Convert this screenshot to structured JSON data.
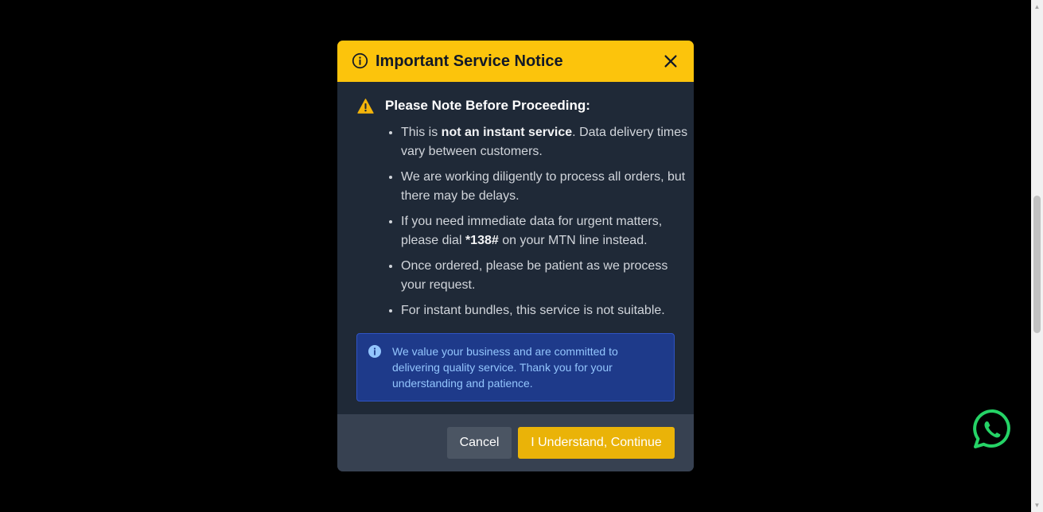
{
  "modal": {
    "title": "Important Service Notice",
    "note_heading": "Please Note Before Proceeding:",
    "items": [
      {
        "pre": "This is ",
        "bold": "not an instant service",
        "post": ". Data delivery times vary between customers."
      },
      {
        "pre": "We are working diligently to process all orders, but there may be delays.",
        "bold": "",
        "post": ""
      },
      {
        "pre": "If you need immediate data for urgent matters, please dial ",
        "bold": "*138#",
        "post": " on your MTN line instead."
      },
      {
        "pre": "Once ordered, please be patient as we process your request.",
        "bold": "",
        "post": ""
      },
      {
        "pre": "For instant bundles, this service is not suitable.",
        "bold": "",
        "post": ""
      }
    ],
    "info_text": "We value your business and are committed to delivering quality service. Thank you for your understanding and patience.",
    "cancel_label": "Cancel",
    "continue_label": "I Understand, Continue"
  },
  "icons": {
    "header": "info-circle-icon",
    "close": "close-icon",
    "warning": "warning-triangle-icon",
    "info": "info-icon",
    "floating": "whatsapp-icon"
  },
  "colors": {
    "header_bg": "#fcc40c",
    "modal_bg": "#1f2937",
    "footer_bg": "#374151",
    "accent": "#eab308",
    "info_bg": "#1e3a8a",
    "info_text": "#93c5fd",
    "whatsapp": "#25d366"
  }
}
